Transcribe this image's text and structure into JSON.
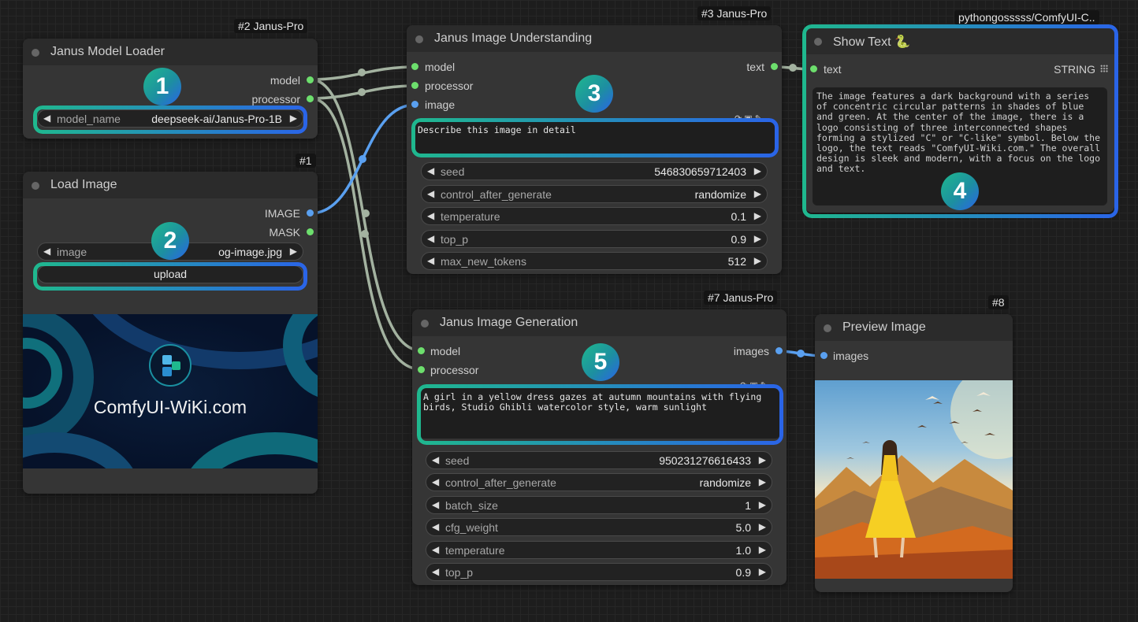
{
  "nodes": {
    "model_loader": {
      "tag": "#2 Janus-Pro",
      "title": "Janus Model Loader",
      "outputs": [
        "model",
        "processor"
      ],
      "widget": {
        "name": "model_name",
        "value": "deepseek-ai/Janus-Pro-1B"
      }
    },
    "load_image": {
      "tag": "#1",
      "title": "Load Image",
      "outputs": [
        "IMAGE",
        "MASK"
      ],
      "widget": {
        "name": "image",
        "value": "og-image.jpg"
      },
      "upload_label": "upload",
      "preview_text": "ComfyUI-WiKi.com"
    },
    "understanding": {
      "tag": "#3 Janus-Pro",
      "title": "Janus Image Understanding",
      "inputs": [
        "model",
        "processor",
        "image"
      ],
      "output": "text",
      "prompt": "Describe this image in detail",
      "widgets": [
        {
          "name": "seed",
          "value": "546830659712403"
        },
        {
          "name": "control_after_generate",
          "value": "randomize"
        },
        {
          "name": "temperature",
          "value": "0.1"
        },
        {
          "name": "top_p",
          "value": "0.9"
        },
        {
          "name": "max_new_tokens",
          "value": "512"
        }
      ]
    },
    "show_text": {
      "tag": "pythongosssss/ComfyUI-C..",
      "title": "Show Text 🐍",
      "input": "text",
      "input_type": "STRING",
      "text": "The image features a dark background with a series of concentric circular patterns in shades of blue and green. At the center of the image, there is a logo consisting of three interconnected shapes forming a stylized \"C\" or \"C-like\" symbol. Below the logo, the text reads \"ComfyUI-Wiki.com.\" The overall design is sleek and modern, with a focus on the logo and text."
    },
    "generation": {
      "tag": "#7 Janus-Pro",
      "title": "Janus Image Generation",
      "inputs": [
        "model",
        "processor"
      ],
      "output": "images",
      "prompt": "A girl in a yellow dress gazes at autumn mountains with flying birds, Studio Ghibli watercolor style, warm sunlight",
      "widgets": [
        {
          "name": "seed",
          "value": "950231276616433"
        },
        {
          "name": "control_after_generate",
          "value": "randomize"
        },
        {
          "name": "batch_size",
          "value": "1"
        },
        {
          "name": "cfg_weight",
          "value": "5.0"
        },
        {
          "name": "temperature",
          "value": "1.0"
        },
        {
          "name": "top_p",
          "value": "0.9"
        }
      ]
    },
    "preview": {
      "tag": "#8",
      "title": "Preview Image",
      "input": "images"
    }
  },
  "badges": [
    "1",
    "2",
    "3",
    "4",
    "5"
  ],
  "colors": {
    "link_model": "#a3b2a0",
    "link_image": "#5aa0f0",
    "highlight_start": "#1fb88e",
    "highlight_end": "#2a64e8"
  },
  "icons": {
    "widget_left": "◀",
    "widget_right": "▶",
    "grid_icon": "grid-icon"
  }
}
